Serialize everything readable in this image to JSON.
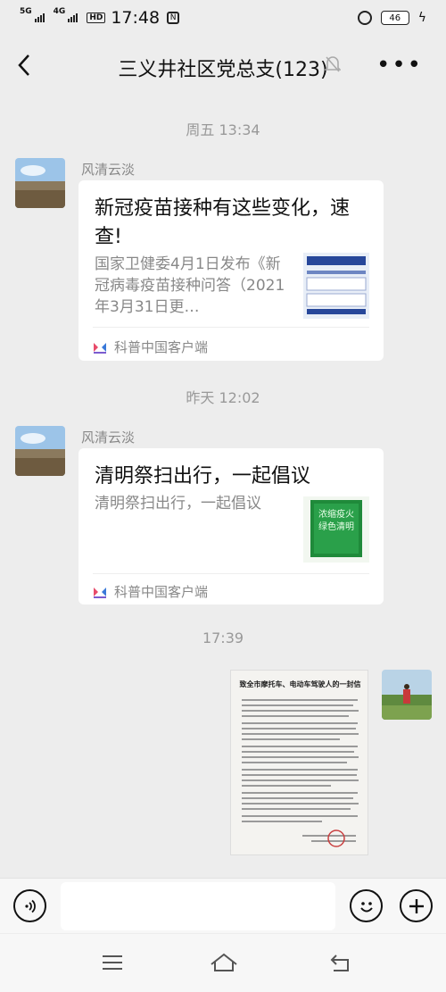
{
  "status": {
    "network1": "5G",
    "network2": "4G",
    "hd": "HD",
    "time": "17:48",
    "nfc": "N",
    "battery": "46"
  },
  "header": {
    "title": "三义井社区党总支(123)",
    "back_icon": "chevron-left-icon",
    "mute_icon": "bell-off-icon",
    "more_icon": "more-icon",
    "more_glyph": "•••"
  },
  "messages": [
    {
      "timestamp": "周五 13:34",
      "sender": "风清云淡",
      "title": "新冠疫苗接种有这些变化，速查!",
      "description": "国家卫健委4月1日发布《新冠病毒疫苗接种问答（2021年3月31日更…",
      "source": "科普中国客户端"
    },
    {
      "timestamp": "昨天 12:02",
      "sender": "风清云淡",
      "title": "清明祭扫出行，一起倡议",
      "description": "清明祭扫出行，一起倡议",
      "source": "科普中国客户端"
    },
    {
      "timestamp": "17:39",
      "image_title": "致全市摩托车、电动车驾驶人的一封信"
    }
  ],
  "thumb1": {
    "heading": "20问了解 新冠病毒疫苗接种"
  },
  "thumb2": {
    "lines": [
      "浓缩疫火",
      "绿色清明"
    ]
  },
  "input": {
    "placeholder": ""
  },
  "colors": {
    "background": "#ededed",
    "card": "#ffffff",
    "muted_text": "#888888"
  }
}
